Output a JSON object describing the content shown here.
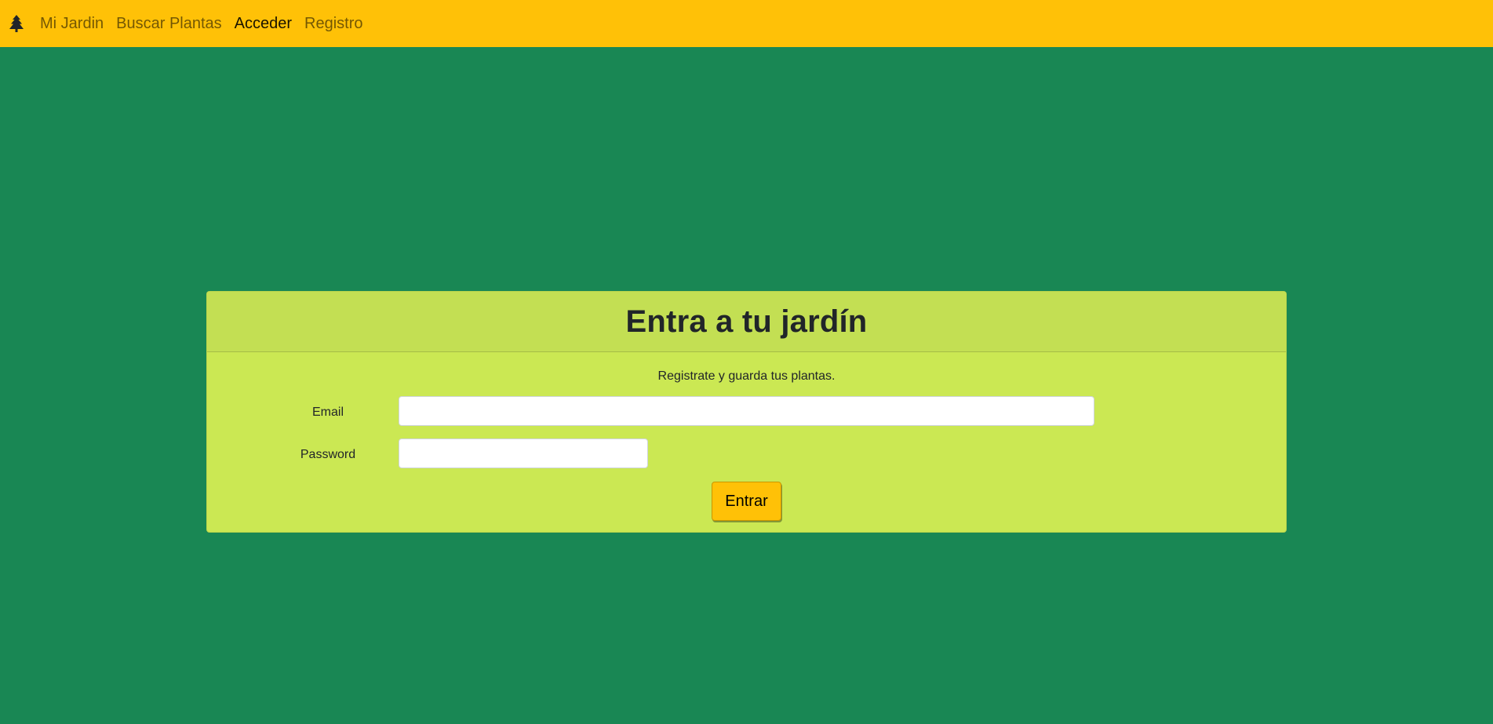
{
  "navbar": {
    "brand_icon": "tree-icon",
    "links": [
      {
        "label": "Mi Jardin",
        "active": false
      },
      {
        "label": "Buscar Plantas",
        "active": false
      },
      {
        "label": "Acceder",
        "active": true
      },
      {
        "label": "Registro",
        "active": false
      }
    ]
  },
  "login": {
    "title": "Entra a tu jardín",
    "subtitle": "Registrate y guarda tus plantas.",
    "email_label": "Email",
    "email_value": "",
    "password_label": "Password",
    "password_value": "",
    "submit_label": "Entrar"
  },
  "colors": {
    "page_background": "#198754",
    "navbar": "#ffc107",
    "card": "#cbe853",
    "card_header": "#c3df53",
    "button": "#ffc107"
  }
}
